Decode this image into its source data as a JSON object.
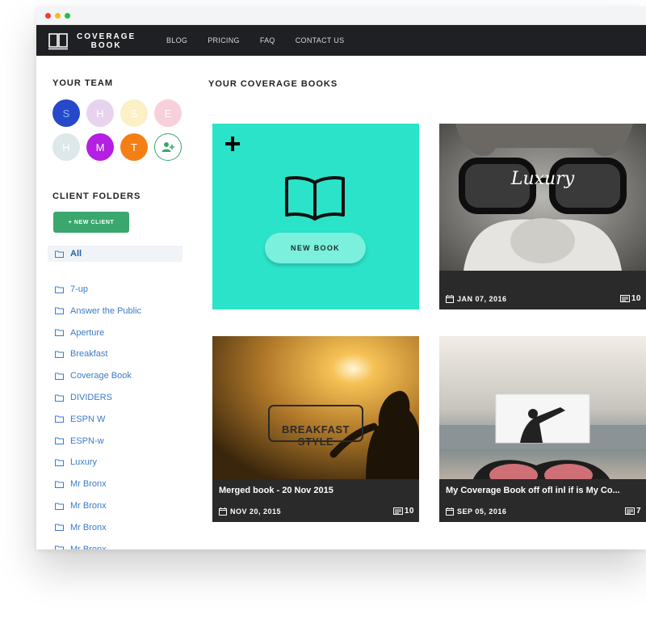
{
  "nav": {
    "brand_line1": "COVERAGE",
    "brand_line2": "BOOK",
    "links": [
      "BLOG",
      "PRICING",
      "FAQ",
      "CONTACT US"
    ]
  },
  "team": {
    "title": "YOUR TEAM",
    "members": [
      {
        "initial": "S",
        "color": "#2549c9"
      },
      {
        "initial": "H",
        "color": "#e8d3ee"
      },
      {
        "initial": "S",
        "color": "#fbf0c6"
      },
      {
        "initial": "E",
        "color": "#f8d0dc"
      },
      {
        "initial": "H",
        "color": "#dce8ea"
      },
      {
        "initial": "M",
        "color": "#b51ee3"
      },
      {
        "initial": "T",
        "color": "#f47f15"
      }
    ],
    "add_member_icon": "add-user-icon"
  },
  "folders": {
    "title": "CLIENT FOLDERS",
    "new_client_label": "+ NEW CLIENT",
    "all_label": "All",
    "items": [
      "7-up",
      "Answer the Public",
      "Aperture",
      "Breakfast",
      "Coverage Book",
      "DIVIDERS",
      "ESPN W",
      "ESPN-w",
      "Luxury",
      "Mr Bronx",
      "Mr Bronx",
      "Mr Bronx",
      "Mr Bronx"
    ]
  },
  "main": {
    "title": "YOUR COVERAGE BOOKS",
    "new_book_label": "NEW BOOK",
    "books": [
      {
        "name": "",
        "date": "JAN 07, 2016",
        "count": "10",
        "logo_text": "Luxury"
      },
      {
        "name": "Merged book - 20 Nov 2015",
        "date": "NOV 20, 2015",
        "count": "10",
        "logo_text": "BREAKFAST STYLE"
      },
      {
        "name": "My Coverage Book off ofl inl if is My Co...",
        "date": "SEP 05, 2016",
        "count": "7",
        "logo_text": ""
      }
    ]
  },
  "colors": {
    "accent_teal": "#2be3c9",
    "button_green": "#3aa76d",
    "link_blue": "#3b7cc6",
    "nav_dark": "#1f2023"
  }
}
